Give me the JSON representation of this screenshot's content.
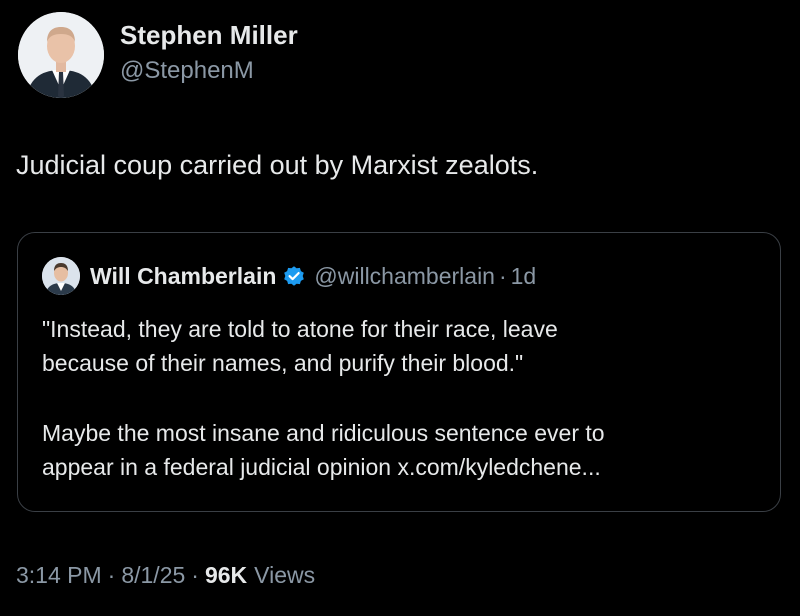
{
  "tweet": {
    "author": {
      "name": "Stephen Miller",
      "handle": "@StephenM"
    },
    "text": "Judicial coup carried out by Marxist zealots.",
    "quoted": {
      "author_name": "Will Chamberlain",
      "verified": true,
      "handle": "@willchamberlain",
      "separator": "·",
      "time": "1d",
      "paragraph_1_line_1": "\"Instead, they are told to atone for their race, leave",
      "paragraph_1_line_2": "because of their names, and purify their blood.\"",
      "paragraph_2_line_1": "Maybe the most insane and ridiculous sentence ever to",
      "paragraph_2_line_2": "appear in a federal judicial opinion x.com/kyledchene..."
    },
    "meta": {
      "time": "3:14 PM",
      "separator_1": "·",
      "date": "8/1/25",
      "separator_2": "·",
      "views_count": "96K",
      "views_label": "Views"
    }
  },
  "colors": {
    "background": "#000000",
    "primary_text": "#e7e9ea",
    "secondary_text": "#8b98a5",
    "card_border": "#3a3f45",
    "verified_badge": "#1d9bf0"
  },
  "icons": {
    "verified": "verified-badge-icon"
  }
}
